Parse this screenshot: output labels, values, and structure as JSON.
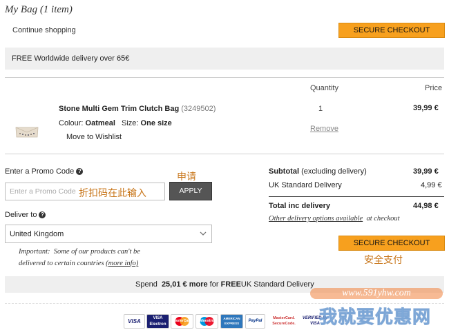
{
  "page": {
    "title": "My Bag (1 item)",
    "continue_shopping": "Continue shopping",
    "secure_checkout": "SECURE CHECKOUT",
    "delivery_banner": "FREE Worldwide delivery over 65€"
  },
  "table": {
    "col_quantity": "Quantity",
    "col_price": "Price"
  },
  "item": {
    "name": "Stone Multi Gem Trim Clutch Bag",
    "code": "(3249502)",
    "colour_label": "Colour:",
    "colour_value": "Oatmeal",
    "size_label": "Size:",
    "size_value": "One size",
    "move_to_wishlist": "Move to Wishlist",
    "quantity": "1",
    "remove": "Remove",
    "price": "39,99 €"
  },
  "promo": {
    "label": "Enter a Promo Code",
    "placeholder": "Enter a Promo Code",
    "apply": "APPLY",
    "annotation_apply": "申请",
    "annotation_input": "折扣码在此输入"
  },
  "deliver": {
    "label": "Deliver to",
    "country": "United Kingdom",
    "important_label": "Important:",
    "important_text": "Some of our products can't be",
    "important_text2": "delivered to certain countries",
    "more_info": "(more info)"
  },
  "summary": {
    "subtotal_label": "Subtotal",
    "subtotal_note": "(excluding delivery)",
    "subtotal_value": "39,99 €",
    "uk_delivery_label": "UK Standard Delivery",
    "uk_delivery_value": "4,99 €",
    "total_label": "Total inc delivery",
    "total_value": "44,98 €",
    "other_options": "Other delivery options available",
    "other_options_suffix": "at checkout",
    "annotation_checkout": "安全支付"
  },
  "spend": {
    "prefix": "Spend",
    "amount": "25,01 €",
    "more": "more",
    "for": "for",
    "free": "FREE",
    "suffix": "UK Standard Delivery"
  },
  "payment": {
    "visa": "VISA",
    "visa_electron": "VISA Electron",
    "mastercard": "MasterCard",
    "maestro": "Maestro",
    "amex": "AMERICAN EXPRESS",
    "paypal": "PayPal",
    "securecode": "MasterCard. SecureCode.",
    "verified_by_visa": "VERIFIED by VISA"
  },
  "watermark": {
    "url": "www.591yhw.com",
    "text": "我就要优惠网"
  },
  "colors": {
    "accent": "#f7a01e",
    "bar": "#efefef",
    "annotation": "#c8761a"
  }
}
